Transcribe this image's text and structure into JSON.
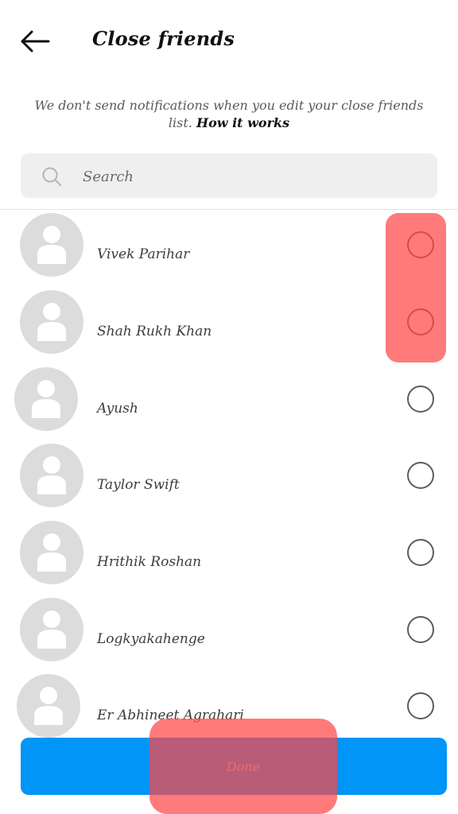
{
  "header": {
    "title": "Close friends",
    "back_icon": "arrow-left-icon"
  },
  "notice": {
    "text": "We don't send notifications when you edit your close friends list.",
    "link_label": "How it works"
  },
  "search": {
    "placeholder": "Search",
    "value": "",
    "icon": "search-icon"
  },
  "friends": [
    {
      "name": "Vivek Parihar",
      "selected": false
    },
    {
      "name": "Shah Rukh Khan",
      "selected": false
    },
    {
      "name": "Ayush",
      "selected": false
    },
    {
      "name": "Taylor Swift",
      "selected": false
    },
    {
      "name": "Hrithik Roshan",
      "selected": false
    },
    {
      "name": "Logkyakahenge",
      "selected": false
    },
    {
      "name": "Er Abhineet Agrahari",
      "selected": false
    }
  ],
  "footer": {
    "done_label": "Done"
  },
  "colors": {
    "accent": "#0095f6",
    "highlight": "#ff4646",
    "avatar_bg": "#dcdcdc"
  }
}
